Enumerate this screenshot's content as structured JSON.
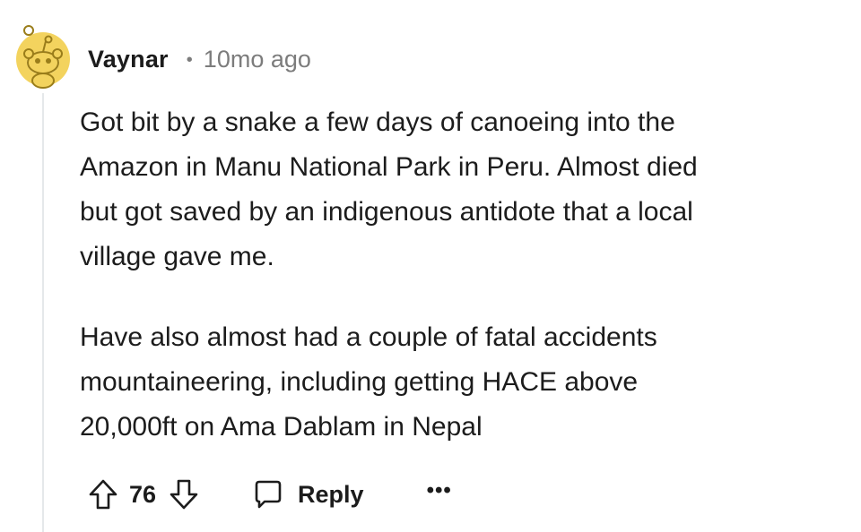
{
  "comment": {
    "author": "Vaynar",
    "separator": "•",
    "timestamp": "10mo ago",
    "paragraphs": [
      "Got bit by a snake a few days of canoeing into the\nAmazon in Manu National Park in Peru. Almost died\nbut got saved by an indigenous antidote that a local\nvillage gave me.",
      "Have also almost had a couple of fatal accidents\nmountaineering, including getting HACE above\n20,000ft on Ama Dablam in Nepal"
    ],
    "vote_count": "76",
    "reply_label": "Reply",
    "more_label": "•••"
  },
  "icons": {
    "avatar": "snoo-avatar-icon",
    "upvote": "arrow-up-icon",
    "downvote": "arrow-down-icon",
    "reply": "speech-bubble-icon",
    "more": "ellipsis-icon"
  },
  "colors": {
    "avatar_bg": "#F3D35E",
    "text": "#1C1C1C",
    "muted": "#7C7C7C",
    "thread_line": "#E5E8EA"
  }
}
